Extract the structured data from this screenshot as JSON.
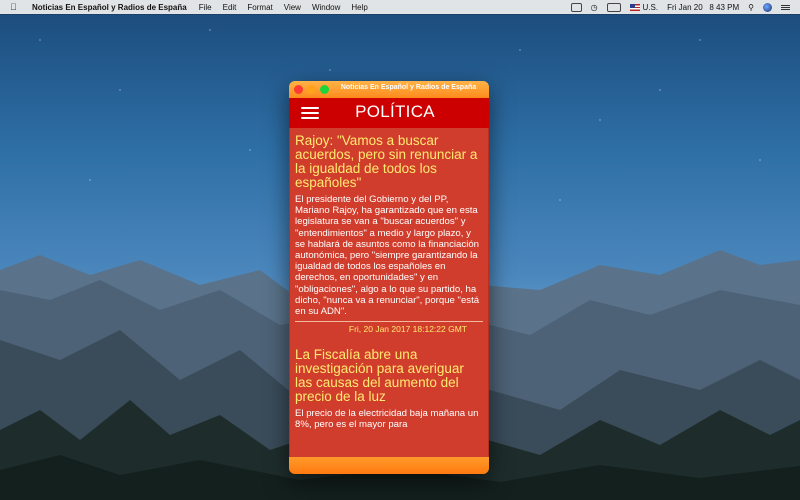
{
  "menubar": {
    "app_name": "Noticias En Español y Radios de España",
    "menus": [
      "File",
      "Edit",
      "Format",
      "View",
      "Window",
      "Help"
    ],
    "input_source": "U.S.",
    "clock": "Fri Jan 20   8 43 PM",
    "icons": [
      "apple-logo",
      "cc-icon",
      "time-machine-icon",
      "battery-icon",
      "flag-us-icon",
      "search-icon",
      "siri-icon",
      "notification-center-icon"
    ]
  },
  "window": {
    "title": "Noticias En Español y Radios de España",
    "section_title": "POLÍTICA",
    "articles": [
      {
        "headline": "Rajoy: \"Vamos a buscar acuerdos, pero sin renunciar a la igualdad de todos los españoles\"",
        "summary": "El presidente del Gobierno y del PP, Mariano Rajoy, ha garantizado que en esta legislatura se van a \"buscar acuerdos\" y \"entendimientos\" a medio y largo plazo, y se hablará de asuntos como la financiación autonómica, pero \"siempre garantizando la igualdad de todos los españoles en derechos, en oportunidades\" y en \"obligaciones\", algo a lo que su partido, ha dicho, \"nunca va a renunciar\", porque \"está en su ADN\".",
        "date": "Fri, 20 Jan 2017 18:12:22 GMT"
      },
      {
        "headline": "La Fiscalía abre una investigación para averiguar las causas del aumento del precio de la luz",
        "summary": "El precio de la electricidad baja mañana un 8%, pero es el mayor para"
      }
    ]
  },
  "colors": {
    "titlebar": "#ff8a1c",
    "navbar": "#cc0000",
    "content_bg": "#d13d2c",
    "headline": "#ffea70"
  }
}
